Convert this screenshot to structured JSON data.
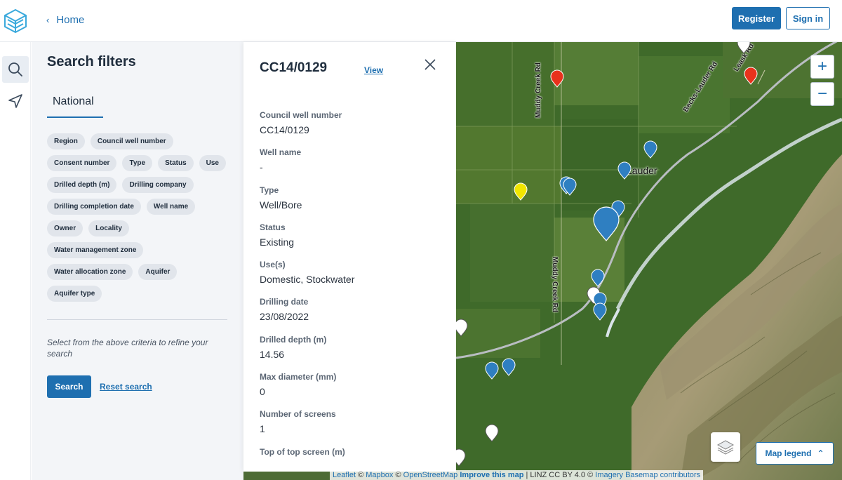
{
  "header": {
    "home_label": "Home",
    "register_label": "Register",
    "signin_label": "Sign in"
  },
  "filters": {
    "title": "Search filters",
    "tab": "National",
    "chips": [
      "Region",
      "Council well number",
      "Consent number",
      "Type",
      "Status",
      "Use",
      "Drilled depth (m)",
      "Drilling company",
      "Drilling completion date",
      "Well name",
      "Owner",
      "Locality",
      "Water management zone",
      "Water allocation zone",
      "Aquifer",
      "Aquifer type"
    ],
    "hint": "Select from the above criteria to refine your search",
    "search_label": "Search",
    "reset_label": "Reset search"
  },
  "detail": {
    "well_id": "CC14/0129",
    "view_label": "View",
    "fields": [
      {
        "label": "Council well number",
        "value": "CC14/0129"
      },
      {
        "label": "Well name",
        "value": "-"
      },
      {
        "label": "Type",
        "value": "Well/Bore"
      },
      {
        "label": "Status",
        "value": "Existing"
      },
      {
        "label": "Use(s)",
        "value": "Domestic, Stockwater"
      },
      {
        "label": "Drilling date",
        "value": "23/08/2022"
      },
      {
        "label": "Drilled depth (m)",
        "value": "14.56"
      },
      {
        "label": "Max diameter (mm)",
        "value": "0"
      },
      {
        "label": "Number of screens",
        "value": "1"
      },
      {
        "label": "Top of top screen (m)",
        "value": ""
      }
    ]
  },
  "map": {
    "zoom_in": "+",
    "zoom_out": "−",
    "legend_label": "Map legend",
    "town": "Lauder",
    "roads": [
      "Muddy Creek Rd",
      "Becks-Lauder Rd",
      "Leask Rd",
      "Muddy Creek Rd"
    ],
    "attribution": {
      "leaflet": "Leaflet",
      "mapbox": "Mapbox",
      "osm": "OpenStreetMap",
      "improve": "Improve this map",
      "linz": "| LINZ CC BY 4.0 ©",
      "imagery": "Imagery Basemap contributors",
      "copy1": "©",
      "copy2": "©"
    },
    "marker_colors": {
      "blue": "#2f7fc1",
      "red": "#e8321c",
      "yellow": "#f2e600",
      "white": "#ffffff"
    }
  }
}
